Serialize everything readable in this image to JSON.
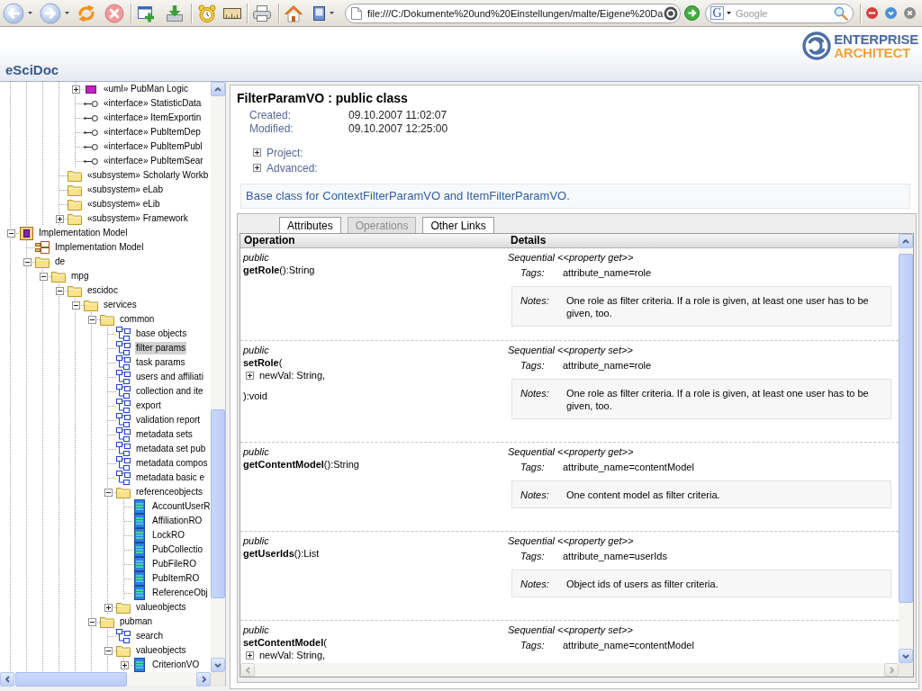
{
  "browser": {
    "address": "file:///C:/Dokumente%20und%20Einstellungen/malte/Eigene%20Da",
    "search": {
      "engine": "G",
      "placeholder": "Google"
    }
  },
  "header": {
    "logo": [
      "ENTERPRISE",
      "ARCHITECT"
    ],
    "site_title": "eSciDoc"
  },
  "tree": {
    "items": [
      {
        "children": [
          {
            "children": [
              {
                "children": [
                  {
                    "children": [
                      {
                        "label": "«uml» PubMan Logic",
                        "kind": "uml",
                        "expanded": false,
                        "selected": false
                      },
                      {
                        "label": "«interface» StatisticData",
                        "kind": "interface",
                        "selected": false
                      },
                      {
                        "label": "«interface» ItemExportin",
                        "kind": "interface",
                        "selected": false
                      },
                      {
                        "label": "«interface» PubItemDep",
                        "kind": "interface",
                        "selected": false
                      },
                      {
                        "label": "«interface» PubItemPubl",
                        "kind": "interface",
                        "selected": false
                      },
                      {
                        "label": "«interface» PubItemSear",
                        "kind": "interface",
                        "selected": false
                      }
                    ]
                  },
                  {
                    "label": "«subsystem» Scholarly Workb",
                    "kind": "folder",
                    "selected": false
                  },
                  {
                    "label": "«subsystem» eLab",
                    "kind": "folder",
                    "selected": false
                  },
                  {
                    "label": "«subsystem» eLib",
                    "kind": "folder",
                    "selected": false
                  },
                  {
                    "label": "«subsystem» Framework",
                    "kind": "folder",
                    "expanded": false,
                    "selected": false
                  }
                ]
              }
            ]
          }
        ]
      },
      {
        "label": "Implementation Model",
        "kind": "model",
        "expanded": true,
        "selected": false,
        "children": [
          {
            "label": "Implementation Model",
            "kind": "component",
            "selected": false
          },
          {
            "label": "de",
            "kind": "folder",
            "expanded": true,
            "selected": false,
            "children": [
              {
                "label": "mpg",
                "kind": "folder",
                "expanded": true,
                "selected": false,
                "children": [
                  {
                    "label": "escidoc",
                    "kind": "folder",
                    "expanded": true,
                    "selected": false,
                    "children": [
                      {
                        "label": "services",
                        "kind": "folder",
                        "expanded": true,
                        "selected": false,
                        "children": [
                          {
                            "label": "common",
                            "kind": "folder",
                            "expanded": true,
                            "selected": false,
                            "children": [
                              {
                                "label": "base objects",
                                "kind": "diagram",
                                "selected": false
                              },
                              {
                                "label": "filter params",
                                "kind": "diagram",
                                "selected": true
                              },
                              {
                                "label": "task params",
                                "kind": "diagram",
                                "selected": false
                              },
                              {
                                "label": "users and affiliati",
                                "kind": "diagram",
                                "selected": false
                              },
                              {
                                "label": "collection and ite",
                                "kind": "diagram",
                                "selected": false
                              },
                              {
                                "label": "export",
                                "kind": "diagram",
                                "selected": false
                              },
                              {
                                "label": "validation report",
                                "kind": "diagram",
                                "selected": false
                              },
                              {
                                "label": "metadata sets",
                                "kind": "diagram",
                                "selected": false
                              },
                              {
                                "label": "metadata set pub",
                                "kind": "diagram",
                                "selected": false
                              },
                              {
                                "label": "metadata compos",
                                "kind": "diagram",
                                "selected": false
                              },
                              {
                                "label": "metadata basic e",
                                "kind": "diagram",
                                "selected": false
                              },
                              {
                                "label": "referenceobjects",
                                "kind": "folder",
                                "expanded": true,
                                "selected": false,
                                "children": [
                                  {
                                    "label": "AccountUserR",
                                    "kind": "class",
                                    "selected": false
                                  },
                                  {
                                    "label": "AffiliationRO",
                                    "kind": "class",
                                    "selected": false
                                  },
                                  {
                                    "label": "LockRO",
                                    "kind": "class",
                                    "selected": false
                                  },
                                  {
                                    "label": "PubCollectio",
                                    "kind": "class",
                                    "selected": false
                                  },
                                  {
                                    "label": "PubFileRO",
                                    "kind": "class",
                                    "selected": false
                                  },
                                  {
                                    "label": "PubItemRO",
                                    "kind": "class",
                                    "selected": false
                                  },
                                  {
                                    "label": "ReferenceObj",
                                    "kind": "class",
                                    "selected": false
                                  }
                                ]
                              },
                              {
                                "label": "valueobjects",
                                "kind": "folder",
                                "expanded": false,
                                "selected": false
                              }
                            ]
                          },
                          {
                            "label": "pubman",
                            "kind": "folder",
                            "expanded": true,
                            "selected": false,
                            "children": [
                              {
                                "label": "search",
                                "kind": "diagram",
                                "selected": false
                              },
                              {
                                "label": "valueobjects",
                                "kind": "folder",
                                "expanded": true,
                                "selected": false,
                                "children": [
                                  {
                                    "label": "CriterionVO",
                                    "kind": "class",
                                    "expanded": false,
                                    "selected": false
                                  }
                                ]
                              }
                            ]
                          }
                        ]
                      }
                    ]
                  }
                ]
              }
            ]
          }
        ]
      }
    ]
  },
  "details": {
    "title": "FilterParamVO : public class",
    "meta": [
      {
        "label": "Created:",
        "value": "09.10.2007 11:02:07"
      },
      {
        "label": "Modified:",
        "value": "09.10.2007 12:25:00"
      }
    ],
    "sections": [
      {
        "label": "Project:",
        "expanded": false
      },
      {
        "label": "Advanced:",
        "expanded": false
      }
    ],
    "description": "Base class for ContextFilterParamVO and ItemFilterParamVO.",
    "tabs": [
      {
        "label": "Attributes",
        "selected": false
      },
      {
        "label": "Operations",
        "selected": true
      },
      {
        "label": "Other Links",
        "selected": false
      }
    ],
    "table": {
      "columns": [
        "Operation",
        "Details"
      ],
      "rows": [
        {
          "visibility": "public",
          "signature": "**getRole**():String",
          "stereotype": "Sequential <<property get>>",
          "tags": {
            "label": "Tags:",
            "value": "attribute_name=role"
          },
          "notes": {
            "label": "Notes:",
            "text": "One role as filter criteria. If a role is given, at least one user has to be given, too."
          }
        },
        {
          "visibility": "public",
          "signature": "**setRole**(",
          "parameters": [
            {
              "text": "newVal: String,",
              "expanded": false
            }
          ],
          "closing": "):void",
          "stereotype": "Sequential <<property set>>",
          "tags": {
            "label": "Tags:",
            "value": "attribute_name=role"
          },
          "notes": {
            "label": "Notes:",
            "text": "One role as filter criteria. If a role is given, at least one user has to be given, too."
          }
        },
        {
          "visibility": "public",
          "signature": "**getContentModel**():String",
          "stereotype": "Sequential <<property get>>",
          "tags": {
            "label": "Tags:",
            "value": "attribute_name=contentModel"
          },
          "notes": {
            "label": "Notes:",
            "text": "One content model as filter criteria."
          }
        },
        {
          "visibility": "public",
          "signature": "**getUserIds**():List",
          "stereotype": "Sequential <<property get>>",
          "tags": {
            "label": "Tags:",
            "value": "attribute_name=userIds"
          },
          "notes": {
            "label": "Notes:",
            "text": "Object ids of users as filter criteria."
          }
        },
        {
          "visibility": "public",
          "signature": "**setContentModel**(",
          "parameters": [
            {
              "text": "newVal: String,",
              "expanded": false
            }
          ],
          "stereotype": "Sequential <<property set>>",
          "tags": {
            "label": "Tags:",
            "value": "attribute_name=contentModel"
          }
        }
      ]
    }
  }
}
